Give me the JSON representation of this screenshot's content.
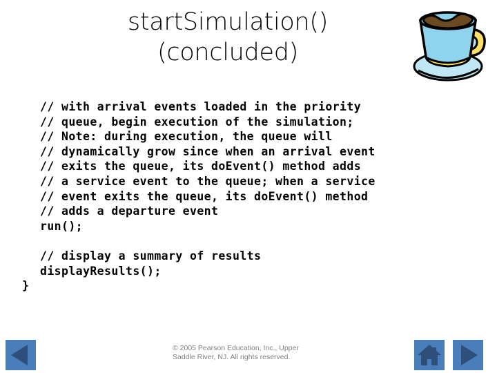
{
  "slide": {
    "title_lines": [
      "startSimulation()",
      "(concluded)"
    ],
    "background_color": "#ffffff",
    "text_color": "#000000"
  },
  "clipart": {
    "name": "coffee-cup",
    "cup_color": "#8fd3ec",
    "coffee_color": "#6b4a22",
    "handle_color": "#ffe066",
    "saucer_color": "#bfe6f5",
    "outline_color": "#000000"
  },
  "code": {
    "lines": [
      "// with arrival events loaded in the priority",
      "// queue, begin execution of the simulation;",
      "// Note: during execution, the queue will",
      "// dynamically grow since when an arrival event",
      "// exits the queue, its doEvent() method adds",
      "// a service event to the queue; when a service",
      "// event exits the queue, its doEvent() method",
      "// adds a departure event",
      "run();",
      "",
      "// display a summary of results",
      "displayResults();"
    ],
    "closing_brace": "}"
  },
  "footer": {
    "line1": "© 2005 Pearson Education, Inc., Upper",
    "line2": "Saddle River, NJ.  All rights reserved.",
    "color": "#808080"
  },
  "navigation": {
    "button_color": "#4a7ebb",
    "glyph_color": "#2e4f7a",
    "back": {
      "label": "Back",
      "icon": "triangle-left-icon"
    },
    "home": {
      "label": "Home",
      "icon": "house-icon"
    },
    "forward": {
      "label": "Forward",
      "icon": "triangle-right-icon"
    }
  }
}
